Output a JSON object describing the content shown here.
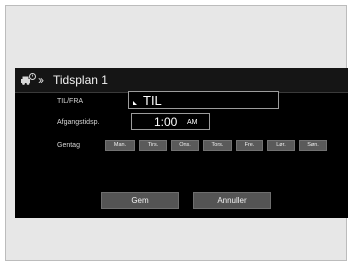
{
  "header": {
    "title": "Tidsplan 1",
    "icon": "car-timer-icon",
    "chevron_icon": "double-chevron-icon"
  },
  "til_row": {
    "label": "TIL/FRA",
    "value": "TIL"
  },
  "time_row": {
    "label": "Afgangstidsp.",
    "time": "1:00",
    "ampm": "AM"
  },
  "repeat_row": {
    "label": "Gentag",
    "days": [
      "Man.",
      "Tirs.",
      "Ons.",
      "Tors.",
      "Fre.",
      "Lør.",
      "Søn."
    ]
  },
  "actions": {
    "save_label": "Gem",
    "cancel_label": "Annuller"
  }
}
